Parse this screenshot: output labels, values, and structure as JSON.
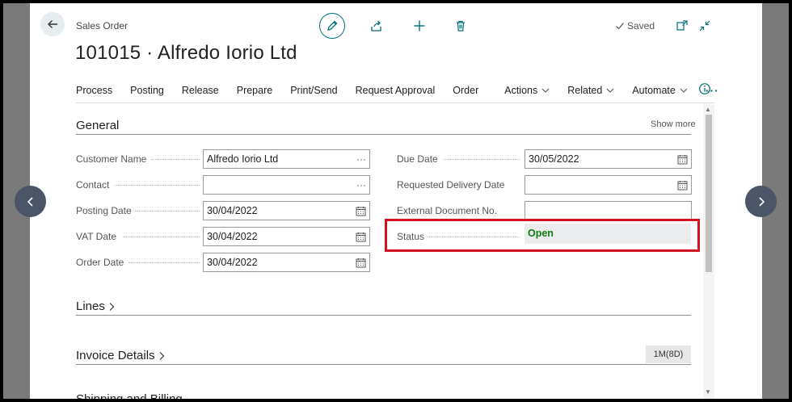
{
  "header": {
    "page_kind": "Sales Order",
    "title": "101015 · Alfredo Iorio Ltd",
    "saved_label": "Saved"
  },
  "actions": {
    "items": [
      "Process",
      "Posting",
      "Release",
      "Prepare",
      "Print/Send",
      "Request Approval",
      "Order"
    ],
    "menus": [
      "Actions",
      "Related",
      "Automate"
    ],
    "more": "···"
  },
  "general": {
    "title": "General",
    "show_more": "Show more",
    "customer_name": {
      "label": "Customer Name",
      "value": "Alfredo Iorio Ltd"
    },
    "contact": {
      "label": "Contact",
      "value": ""
    },
    "posting_date": {
      "label": "Posting Date",
      "value": "30/04/2022"
    },
    "vat_date": {
      "label": "VAT Date",
      "value": "30/04/2022"
    },
    "order_date": {
      "label": "Order Date",
      "value": "30/04/2022"
    },
    "due_date": {
      "label": "Due Date",
      "value": "30/05/2022"
    },
    "requested_delivery_date": {
      "label": "Requested Delivery Date",
      "value": ""
    },
    "external_document_no": {
      "label": "External Document No.",
      "value": ""
    },
    "status": {
      "label": "Status",
      "value": "Open"
    }
  },
  "lines": {
    "title": "Lines"
  },
  "invoice_details": {
    "title": "Invoice Details",
    "badge": "1M(8D)"
  },
  "shipping": {
    "title": "Shipping and Billing"
  },
  "colors": {
    "accent": "#00707a",
    "status_open": "#107c10",
    "highlight": "#d0131f"
  },
  "icons": [
    "back-arrow-icon",
    "pencil-icon",
    "share-icon",
    "plus-icon",
    "trash-icon",
    "checkmark-icon",
    "open-new-window-icon",
    "collapse-icon",
    "info-icon",
    "calendar-icon",
    "chevron-left-icon",
    "chevron-right-icon"
  ]
}
